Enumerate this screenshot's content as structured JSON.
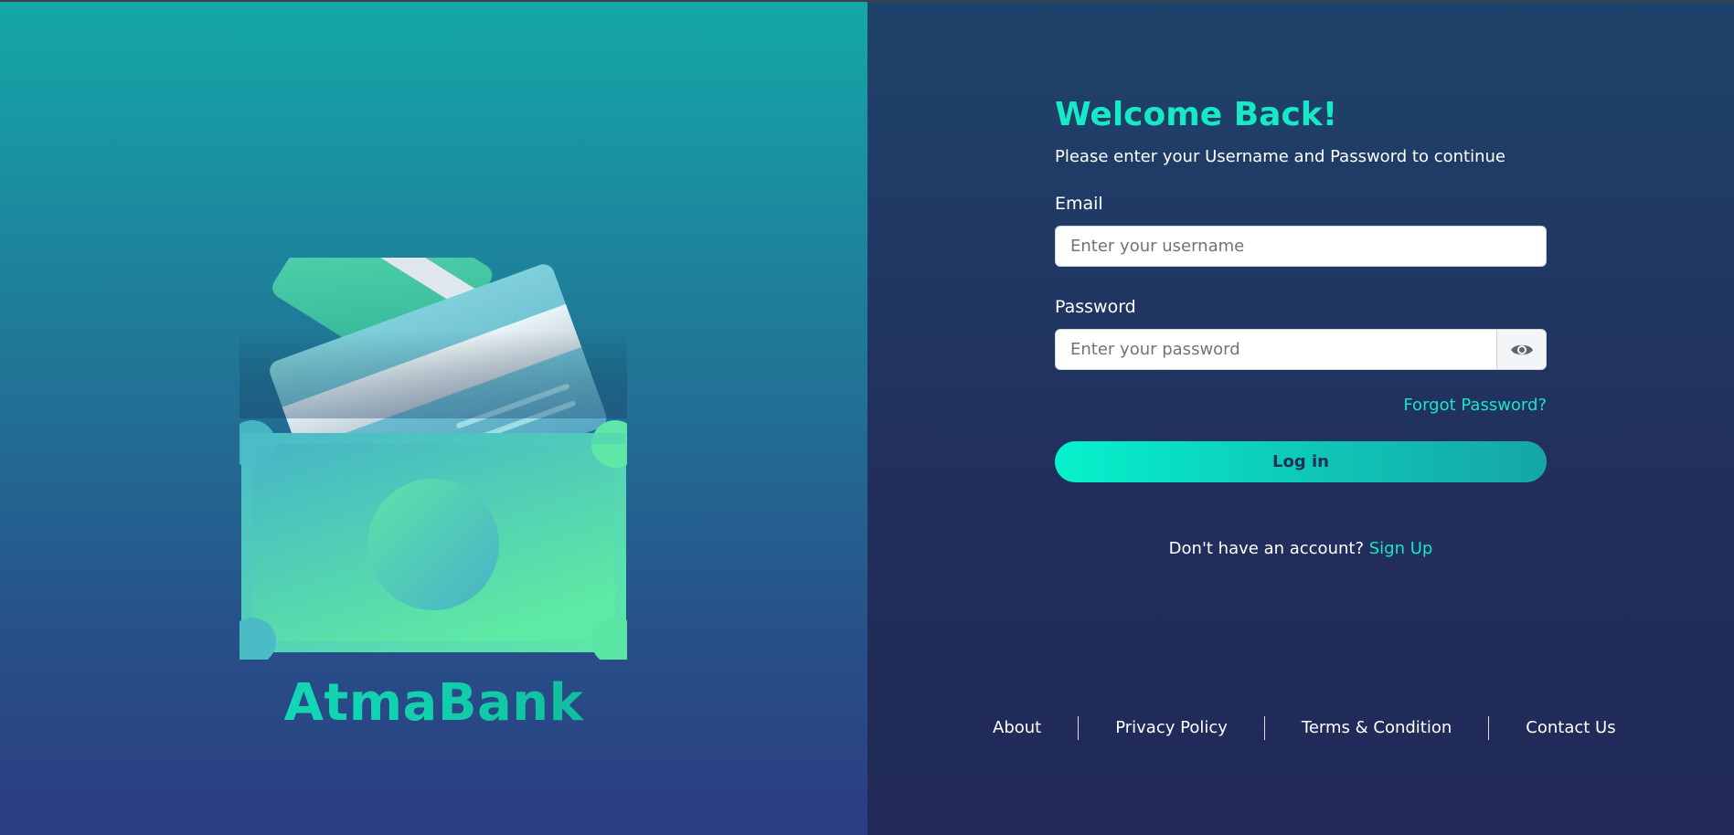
{
  "brand": {
    "name": "AtmaBank"
  },
  "login": {
    "title": "Welcome Back!",
    "subtitle": "Please enter your Username and Password to continue",
    "email_label": "Email",
    "email_placeholder": "Enter your username",
    "password_label": "Password",
    "password_placeholder": "Enter your password",
    "forgot_label": "Forgot Password?",
    "login_button": "Log in",
    "signup_prompt": "Don't have an account?",
    "signup_link": "Sign Up"
  },
  "footer": {
    "links": [
      "About",
      "Privacy Policy",
      "Terms & Condition",
      "Contact Us"
    ]
  },
  "icons": {
    "password_toggle": "eye-icon"
  },
  "colors": {
    "accent": "#19e6c4",
    "panel_dark": "#222e5d",
    "panel_left_top": "#14a8a8",
    "panel_left_bottom": "#2b3c80"
  }
}
